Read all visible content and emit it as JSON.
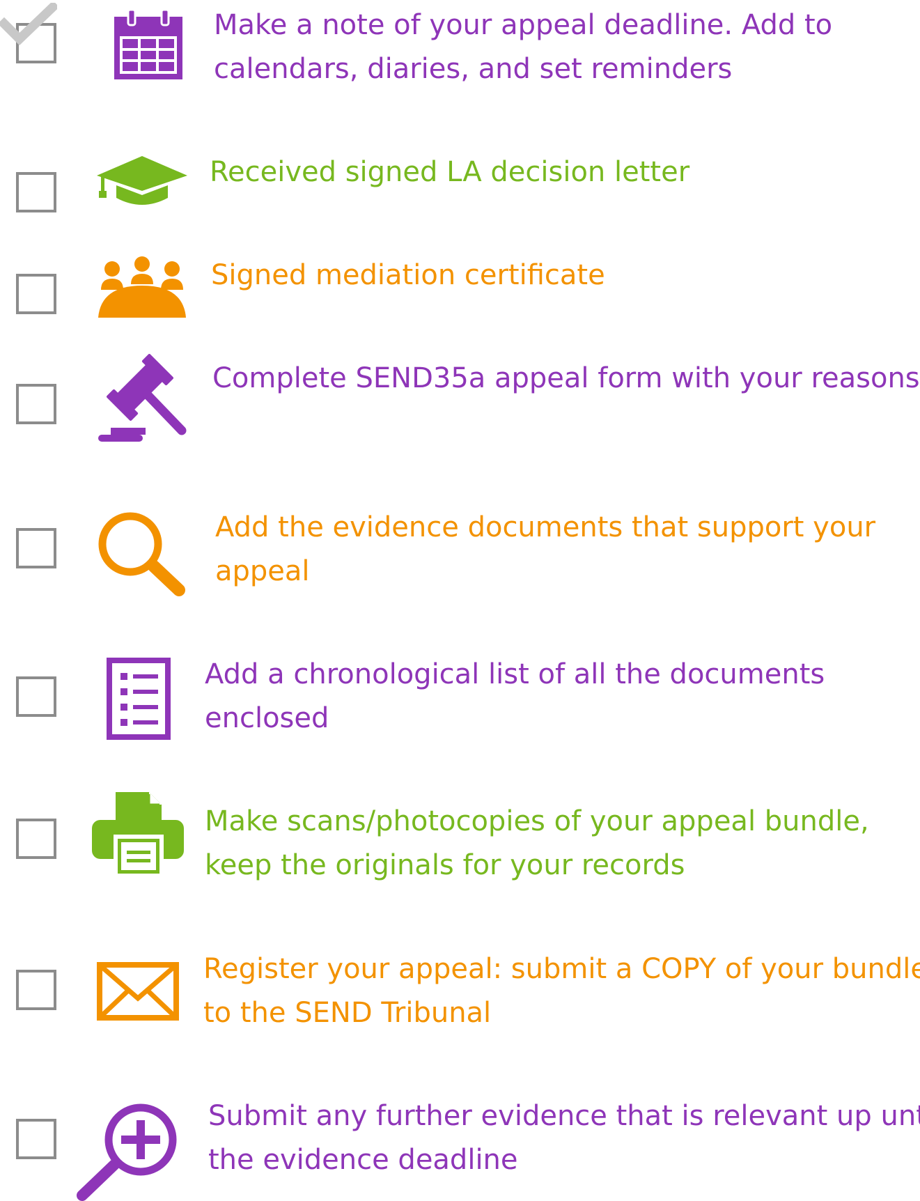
{
  "colors": {
    "purple": "#8e35b8",
    "green": "#77b81f",
    "orange": "#f39200",
    "checkbox_border": "#8c8c8c",
    "checkmark": "#c8c8c8"
  },
  "items": [
    {
      "icon": "calendar-icon",
      "checked": true,
      "line1": "Make a note of your appeal deadline. Add to",
      "line2": "calendars, diaries, and set reminders"
    },
    {
      "icon": "graduation-cap-icon",
      "checked": false,
      "line1": "Received signed LA decision letter",
      "line2": ""
    },
    {
      "icon": "meeting-group-icon",
      "checked": false,
      "line1": "Signed mediation certificate",
      "line2": ""
    },
    {
      "icon": "gavel-icon",
      "checked": false,
      "line1": "Complete SEND35a appeal form with your reasons",
      "line2": ""
    },
    {
      "icon": "magnifier-icon",
      "checked": false,
      "line1": "Add the evidence documents that support your",
      "line2": "appeal"
    },
    {
      "icon": "list-document-icon",
      "checked": false,
      "line1": "Add a chronological list of all the documents",
      "line2": "enclosed"
    },
    {
      "icon": "printer-icon",
      "checked": false,
      "line1": "Make scans/photocopies of your appeal bundle,",
      "line2": "keep the originals for your records"
    },
    {
      "icon": "envelope-icon",
      "checked": false,
      "line1": "Register your appeal: submit a COPY of your bundle",
      "line2": "to the SEND Tribunal"
    },
    {
      "icon": "zoom-in-icon",
      "checked": false,
      "line1": "Submit any further evidence that is relevant up until",
      "line2": "the evidence deadline"
    }
  ]
}
